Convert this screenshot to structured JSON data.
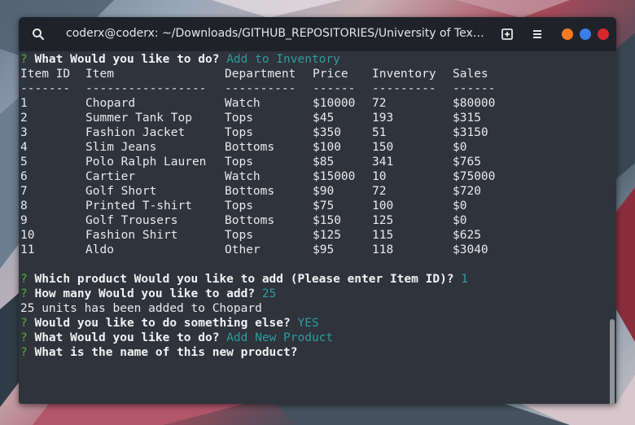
{
  "window": {
    "title": "coderx@coderx: ~/Downloads/GITHUB_REPOSITORIES/University of Texa...",
    "icons": [
      "search-icon",
      "new-tab-icon",
      "menu-icon"
    ],
    "control_colors": {
      "minimize": "#f57a1f",
      "maximize": "#3b7ee6",
      "close": "#d9262c"
    }
  },
  "terminal": {
    "prompt_mark": "?",
    "colors": {
      "prompt": "#5fa83a",
      "answer": "#2f9c9c",
      "text": "#e9eaec",
      "background": "#2e333c"
    },
    "q1": {
      "text": "What Would you like to do?",
      "answer": "Add to Inventory"
    },
    "table": {
      "headers": [
        "Item ID",
        "Item",
        "Department",
        "Price",
        "Inventory",
        "Sales"
      ],
      "separators": [
        "-------",
        "-----------------",
        "----------",
        "------",
        "---------",
        "------"
      ],
      "rows": [
        [
          "1",
          "Chopard",
          "Watch",
          "$10000",
          "72",
          "$80000"
        ],
        [
          "2",
          "Summer Tank Top",
          "Tops",
          "$45",
          "193",
          "$315"
        ],
        [
          "3",
          "Fashion Jacket",
          "Tops",
          "$350",
          "51",
          "$3150"
        ],
        [
          "4",
          "Slim Jeans",
          "Bottoms",
          "$100",
          "150",
          "$0"
        ],
        [
          "5",
          "Polo Ralph Lauren",
          "Tops",
          "$85",
          "341",
          "$765"
        ],
        [
          "6",
          "Cartier",
          "Watch",
          "$15000",
          "10",
          "$75000"
        ],
        [
          "7",
          "Golf Short",
          "Bottoms",
          "$90",
          "72",
          "$720"
        ],
        [
          "8",
          "Printed T-shirt",
          "Tops",
          "$75",
          "100",
          "$0"
        ],
        [
          "9",
          "Golf Trousers",
          "Bottoms",
          "$150",
          "125",
          "$0"
        ],
        [
          "10",
          "Fashion Shirt",
          "Tops",
          "$125",
          "115",
          "$625"
        ],
        [
          "11",
          "Aldo",
          "Other",
          "$95",
          "118",
          "$3040"
        ]
      ]
    },
    "q2": {
      "text": "Which product Would you like to add (Please enter Item ID)?",
      "answer": "1"
    },
    "q3": {
      "text": "How many Would you like to add?",
      "answer": "25"
    },
    "output": "25 units has been added to Chopard",
    "q4": {
      "text": "Would you like to do something else?",
      "answer": "YES"
    },
    "q5": {
      "text": "What Would you like to do?",
      "answer": "Add New Product"
    },
    "q6": {
      "text": "What is the name of this new product?"
    }
  }
}
